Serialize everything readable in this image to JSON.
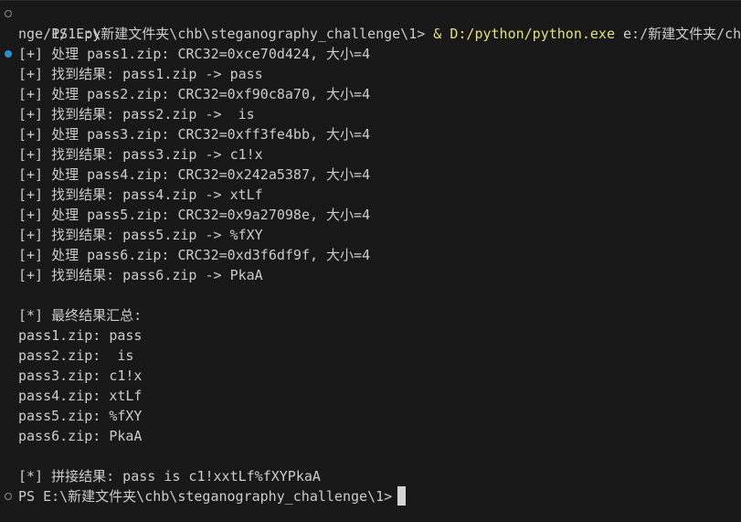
{
  "terminal": {
    "command_line": {
      "prompt": "PS E:\\新建文件夹\\chb\\steganography_challenge\\1> ",
      "operator": "& ",
      "executable": "D:/python/python.exe",
      "script_arg": " e:/新建文件夹/chb",
      "script_arg_wrap": "nge/1/1.py"
    },
    "output_lines": [
      "[+] 处理 pass1.zip: CRC32=0xce70d424, 大小=4",
      "[+] 找到结果: pass1.zip -> pass",
      "[+] 处理 pass2.zip: CRC32=0xf90c8a70, 大小=4",
      "[+] 找到结果: pass2.zip ->  is",
      "[+] 处理 pass3.zip: CRC32=0xff3fe4bb, 大小=4",
      "[+] 找到结果: pass3.zip -> c1!x",
      "[+] 处理 pass4.zip: CRC32=0x242a5387, 大小=4",
      "[+] 找到结果: pass4.zip -> xtLf",
      "[+] 处理 pass5.zip: CRC32=0x9a27098e, 大小=4",
      "[+] 找到结果: pass5.zip -> %fXY",
      "[+] 处理 pass6.zip: CRC32=0xd3f6df9f, 大小=4",
      "[+] 找到结果: pass6.zip -> PkaA"
    ],
    "summary_header": "[*] 最终结果汇总:",
    "summary_lines": [
      "pass1.zip: pass",
      "pass2.zip:  is",
      "pass3.zip: c1!x",
      "pass4.zip: xtLf",
      "pass5.zip: %fXY",
      "pass6.zip: PkaA"
    ],
    "concat_result": "[*] 拼接结果: pass is c1!xxtLf%fXYPkaA",
    "final_prompt": "PS E:\\新建文件夹\\chb\\steganography_challenge\\1>"
  },
  "colors": {
    "background": "#181818",
    "foreground": "#cccccc",
    "command_yellow": "#e5e07b",
    "success_marker": "#2b8fd6",
    "idle_marker": "#8c8c8c"
  }
}
